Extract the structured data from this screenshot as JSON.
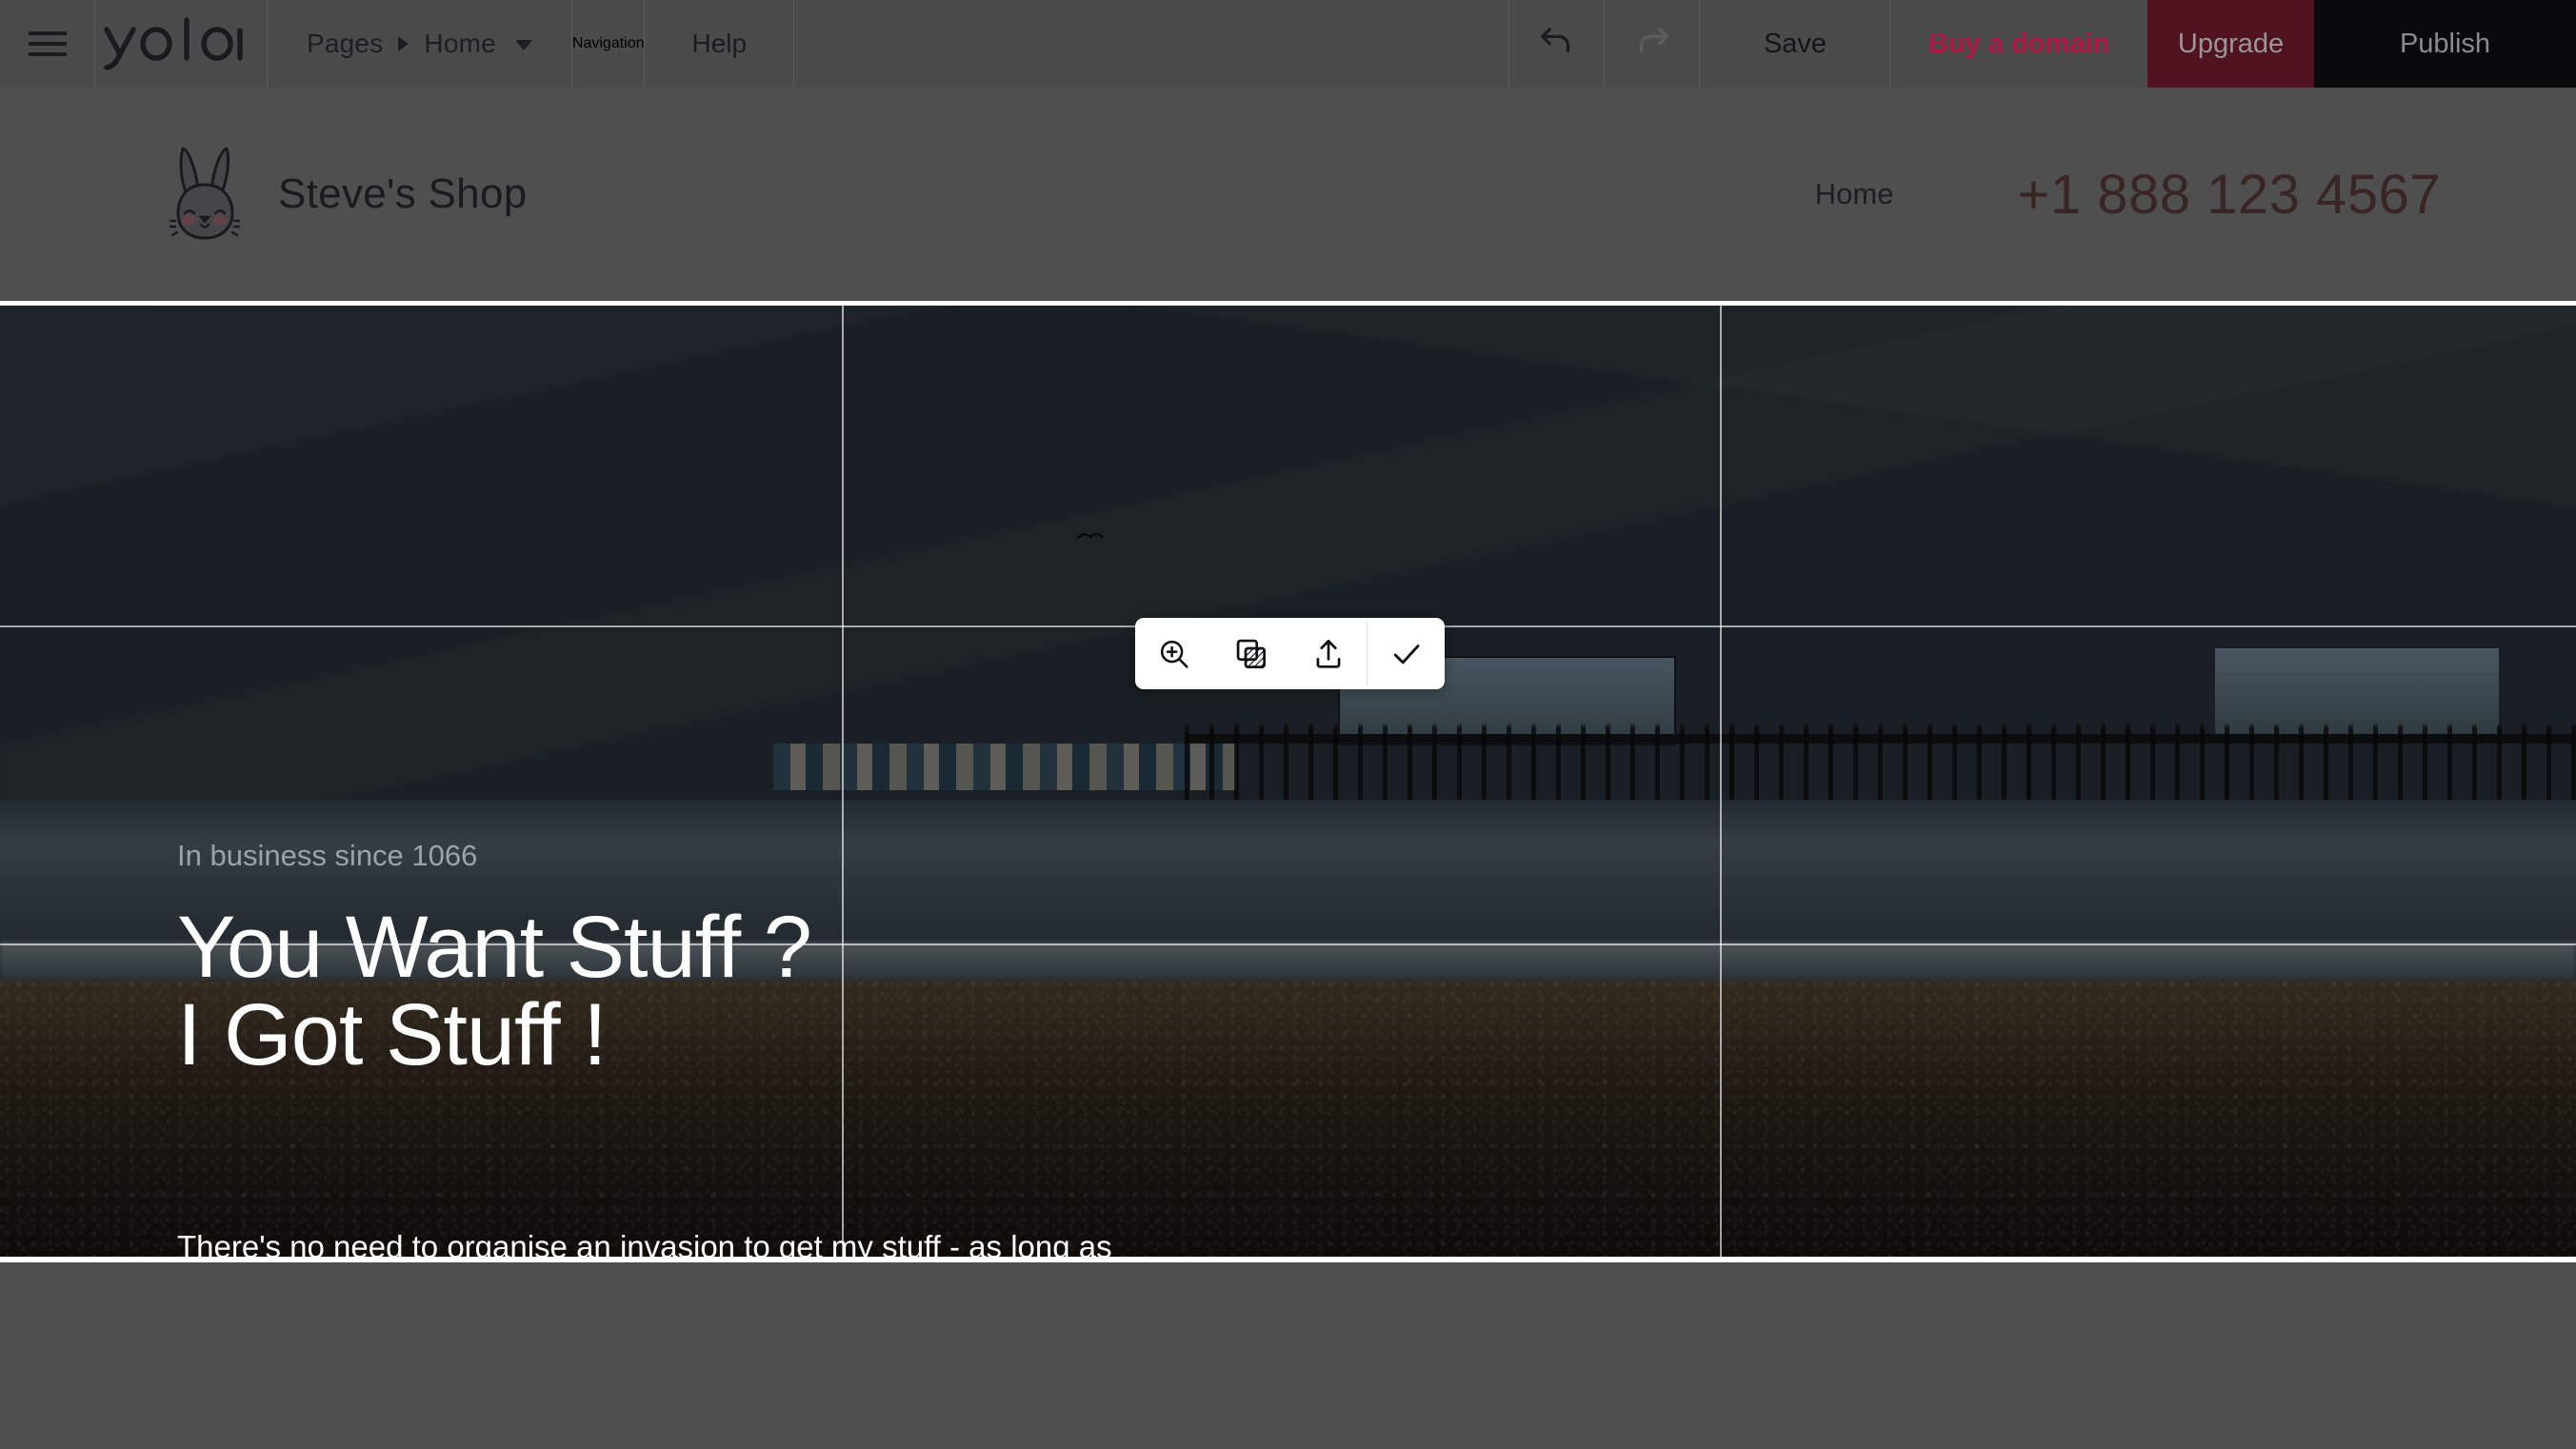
{
  "editor_bar": {
    "menu_icon": "hamburger-icon",
    "logo_text": "yola",
    "pages": {
      "label": "Pages",
      "separator_icon": "chevron-right-icon",
      "current_page": "Home",
      "dropdown_icon": "chevron-down-icon"
    },
    "navigation_label": "Navigation",
    "help_label": "Help",
    "undo": {
      "icon": "undo-arrow-icon",
      "state": "enabled"
    },
    "redo": {
      "icon": "redo-arrow-icon",
      "state": "disabled"
    },
    "save_label": "Save",
    "buy_domain_label": "Buy a domain",
    "upgrade_label": "Upgrade",
    "publish_label": "Publish",
    "colors": {
      "bar_background": "#4b4b4b",
      "buy_domain_text": "#b0184a",
      "upgrade_background": "#511320",
      "publish_background": "#0a090c"
    }
  },
  "site_header": {
    "logo_icon": "bunny-face-logo-icon",
    "title": "Steve's Shop",
    "nav_items": [
      "Home"
    ],
    "phone": "+1 888 123 4567",
    "phone_color": "#3a2525"
  },
  "hero": {
    "kicker": "In business since 1066",
    "heading": "You Want Stuff ?\nI Got Stuff !",
    "body": "There's no need to organise an invasion to get my stuff - as long as\nyou pay the right price, we're get along swell!",
    "selection_state": "image-selected",
    "grid_overlay": "rule-of-thirds",
    "image_description": "beach at dusk with pier"
  },
  "image_toolbar": {
    "buttons": [
      {
        "name": "zoom-in-icon",
        "title": "Zoom"
      },
      {
        "name": "layers-icon",
        "title": "Effects"
      },
      {
        "name": "upload-icon",
        "title": "Upload"
      },
      {
        "name": "check-icon",
        "title": "Done"
      }
    ]
  }
}
